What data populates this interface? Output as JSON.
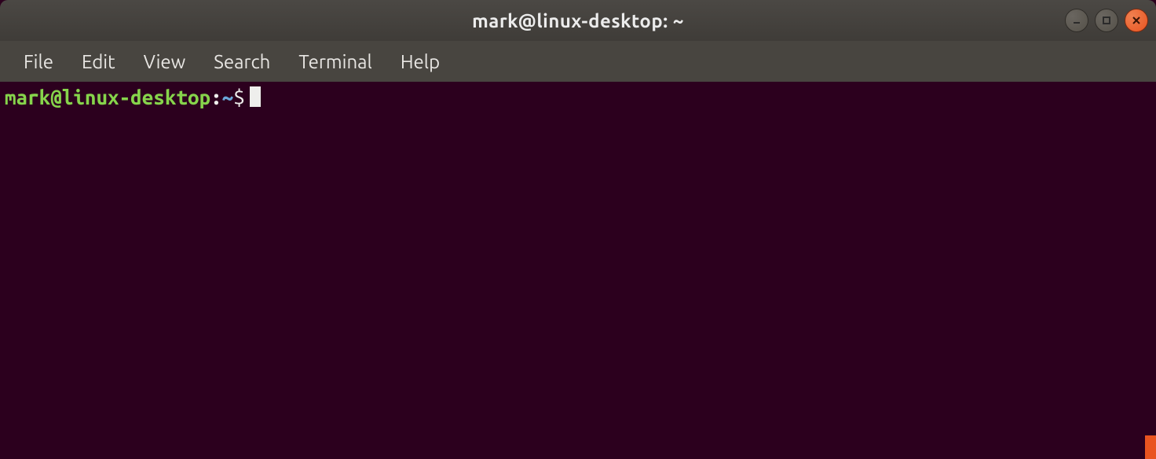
{
  "window": {
    "title": "mark@linux-desktop: ~"
  },
  "menubar": {
    "items": [
      {
        "label": "File"
      },
      {
        "label": "Edit"
      },
      {
        "label": "View"
      },
      {
        "label": "Search"
      },
      {
        "label": "Terminal"
      },
      {
        "label": "Help"
      }
    ]
  },
  "prompt": {
    "user_host": "mark@linux-desktop",
    "colon": ":",
    "path": "~",
    "symbol": "$"
  },
  "colors": {
    "terminal_bg": "#2c001e",
    "prompt_user": "#86d44b",
    "prompt_path": "#6aa7d8",
    "accent": "#e95420"
  }
}
